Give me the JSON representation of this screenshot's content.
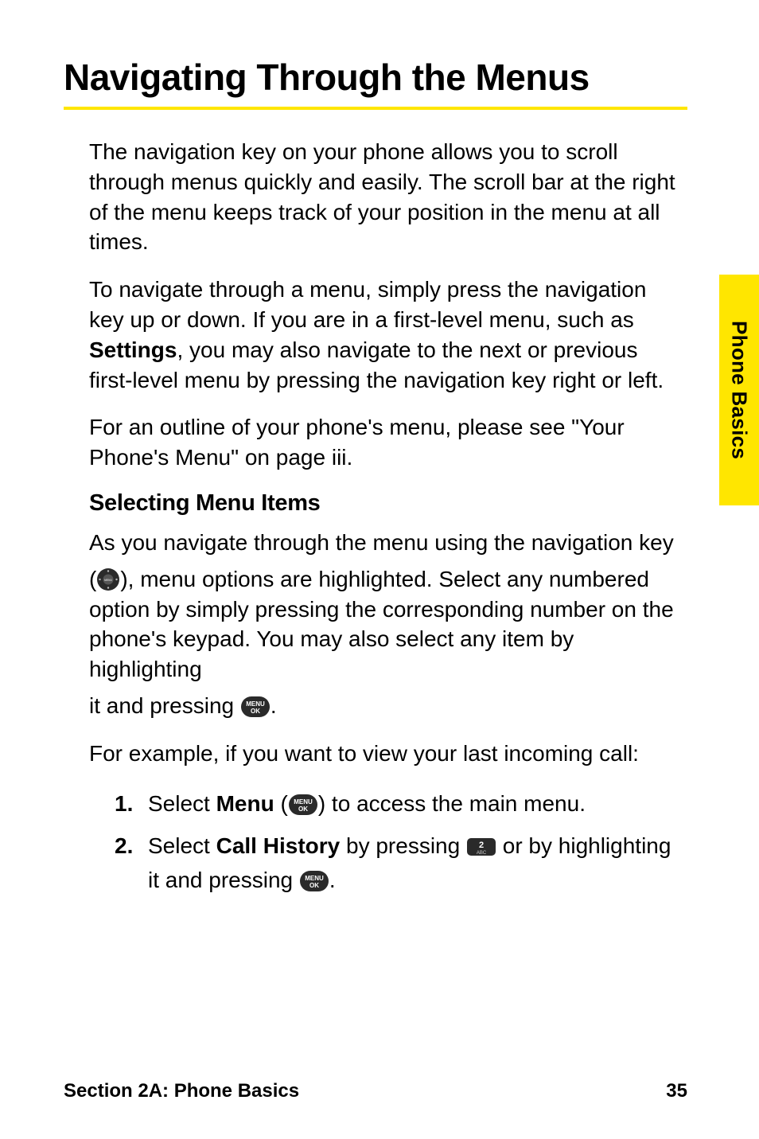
{
  "title": "Navigating Through the Menus",
  "side_tab": "Phone Basics",
  "para1": "The navigation key on your phone allows you to scroll through menus quickly and easily. The scroll bar at the right of the menu keeps track of your position in the menu at all times.",
  "para2_a": "To navigate through a menu, simply press the navigation key up or down. If you are in a first-level menu, such as ",
  "para2_bold": "Settings",
  "para2_b": ", you may also navigate to the next or previous first-level menu by pressing the navigation key right or left.",
  "para3": "For an outline of your phone's menu, please see \"Your Phone's Menu\" on page iii.",
  "subheading": "Selecting Menu Items",
  "para4": "As you navigate through the menu using the navigation key",
  "para5_a": "(",
  "para5_b": "), menu options are highlighted. Select any numbered option by simply pressing the corresponding number on the phone's keypad. You may also select any item by highlighting",
  "para6_a": "it and pressing ",
  "para6_b": ".",
  "para7": "For example, if you want to view your last incoming call:",
  "step1_num": "1.",
  "step1_a": "Select ",
  "step1_bold": "Menu",
  "step1_b": " (",
  "step1_c": ") to access the main menu.",
  "step2_num": "2.",
  "step2_a": "Select ",
  "step2_bold": "Call History",
  "step2_b": " by pressing ",
  "step2_c": " or by highlighting it and pressing ",
  "step2_d": ".",
  "footer_left": "Section 2A: Phone Basics",
  "footer_right": "35",
  "icons": {
    "nav": "nav-key-icon",
    "menu": "menu-ok-icon",
    "key2": "keypad-2-icon"
  }
}
